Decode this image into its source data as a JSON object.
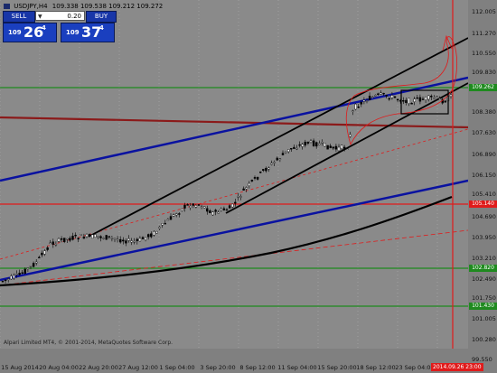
{
  "symbol": "USDJPY,H4",
  "quote_line": "109.338 109.538 109.212 109.272",
  "trade_panel": {
    "sell_label": "SELL",
    "buy_label": "BUY",
    "volume": "0.20",
    "bid_small": "109",
    "bid_big": "26",
    "bid_sup": "4",
    "ask_small": "109",
    "ask_big": "37",
    "ask_sup": "4"
  },
  "copyright": "Alpari Limited MT4, © 2001-2014, MetaQuotes Software Corp.",
  "y_axis": {
    "ticks": [
      "112.005",
      "111.270",
      "110.550",
      "109.830",
      "108.380",
      "107.630",
      "106.890",
      "106.150",
      "105.410",
      "104.690",
      "103.950",
      "103.210",
      "102.490",
      "101.750",
      "101.005",
      "100.280",
      "99.550"
    ]
  },
  "horizontal_labels": [
    {
      "text": "109.262",
      "color": "#1f8a1f"
    },
    {
      "text": "105.140",
      "color": "#e01b1b"
    },
    {
      "text": "102.820",
      "color": "#1f8a1f"
    },
    {
      "text": "101.430",
      "color": "#1f8a1f"
    }
  ],
  "x_axis": {
    "ticks": [
      "15 Aug 2014",
      "20 Aug 04:00",
      "22 Aug 20:00",
      "27 Aug 12:00",
      "1 Sep 04:00",
      "3 Sep 20:00",
      "8 Sep 12:00",
      "11 Sep 04:00",
      "15 Sep 20:00",
      "18 Sep 12:00",
      "23 Sep 04:00"
    ]
  },
  "vertical_marker_label": "2014.09.26 23:00",
  "colors": {
    "channel_blue": "#0a12a0",
    "channel_black": "#000000",
    "resistance_red": "#e01b1b",
    "support_green": "#1f8a1f",
    "dark_red": "#8b1a1a",
    "bull_candle": "#ffffff",
    "bear_candle": "#000000"
  }
}
